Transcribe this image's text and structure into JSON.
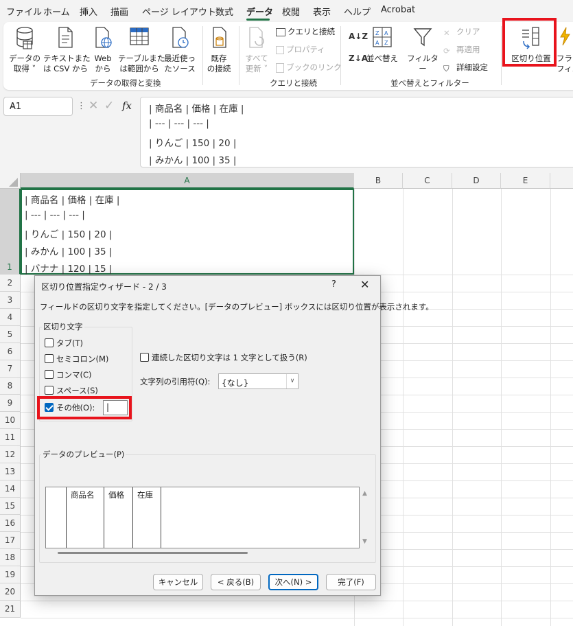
{
  "menu": {
    "tabs": [
      "ファイル",
      "ホーム",
      "挿入",
      "描画",
      "ページ レイアウト",
      "数式",
      "データ",
      "校閲",
      "表示",
      "ヘルプ",
      "Acrobat"
    ],
    "active": "データ"
  },
  "ribbon": {
    "get_data": "データの\n取得 ˅",
    "text_csv": "テキストまた\nは CSV から",
    "web": "Web\nから",
    "table_range": "テーブルまた\nは範囲から",
    "recent_sources": "最近使っ\nたソース",
    "existing_conn": "既存\nの接続",
    "group_get_transform": "データの取得と変換",
    "refresh_all": "すべて\n更新 ˅",
    "queries_conn": "クエリと接続",
    "properties": "プロパティ",
    "edit_links": "ブックのリンク",
    "group_queries": "クエリと接続",
    "sort_az": "A↓Z",
    "sort_za": "Z↓A",
    "sort": "並べ替え",
    "filter": "フィルター",
    "clear": "クリア",
    "reapply": "再適用",
    "advanced": "詳細設定",
    "group_sort_filter": "並べ替えとフィルター",
    "text_to_columns": "区切り位置",
    "flash_fill": "フラッシュ\nフィル"
  },
  "formula_bar": {
    "name_box": "A1",
    "fx": "fx",
    "lines": [
      "| 商品名 | 価格 | 在庫 |",
      "| --- | --- | --- |",
      "| りんご | 150 | 20 |",
      "| みかん | 100 | 35 |"
    ]
  },
  "sheet": {
    "columns": [
      "A",
      "B",
      "C",
      "D",
      "E"
    ],
    "rows": [
      "1",
      "2",
      "3",
      "4",
      "5",
      "6",
      "7",
      "8",
      "9",
      "10",
      "11",
      "12",
      "13",
      "14",
      "15",
      "16",
      "17",
      "18",
      "19",
      "20",
      "21"
    ],
    "cell_a1_lines": [
      "| 商品名 | 価格 | 在庫 |",
      "| --- | --- | --- |",
      "| りんご | 150 | 20 |",
      "| みかん | 100 | 35 |",
      "| バナナ | 120 | 15 |"
    ]
  },
  "dialog": {
    "title": "区切り位置指定ウィザード - 2 / 3",
    "help": "?",
    "close": "✕",
    "instruction": "フィールドの区切り文字を指定してください。[データのプレビュー] ボックスには区切り位置が表示されます。",
    "delimiters_label": "区切り文字",
    "tab": "タブ(T)",
    "semicolon": "セミコロン(M)",
    "comma": "コンマ(C)",
    "space": "スペース(S)",
    "other": "その他(O):",
    "other_value": "|",
    "consecutive": "連続した区切り文字は 1 文字として扱う(R)",
    "qualifier_label": "文字列の引用符(Q):",
    "qualifier_value": "{なし}",
    "preview_label": "データのプレビュー(P)",
    "preview_columns": [
      "",
      "商品名",
      "価格",
      "在庫",
      ""
    ],
    "cancel": "キャンセル",
    "back": "< 戻る(B)",
    "next": "次へ(N) >",
    "finish": "完了(F)"
  },
  "colors": {
    "excel_green": "#217346",
    "highlight_red": "#e8131c",
    "checkbox_blue": "#0067c0"
  }
}
